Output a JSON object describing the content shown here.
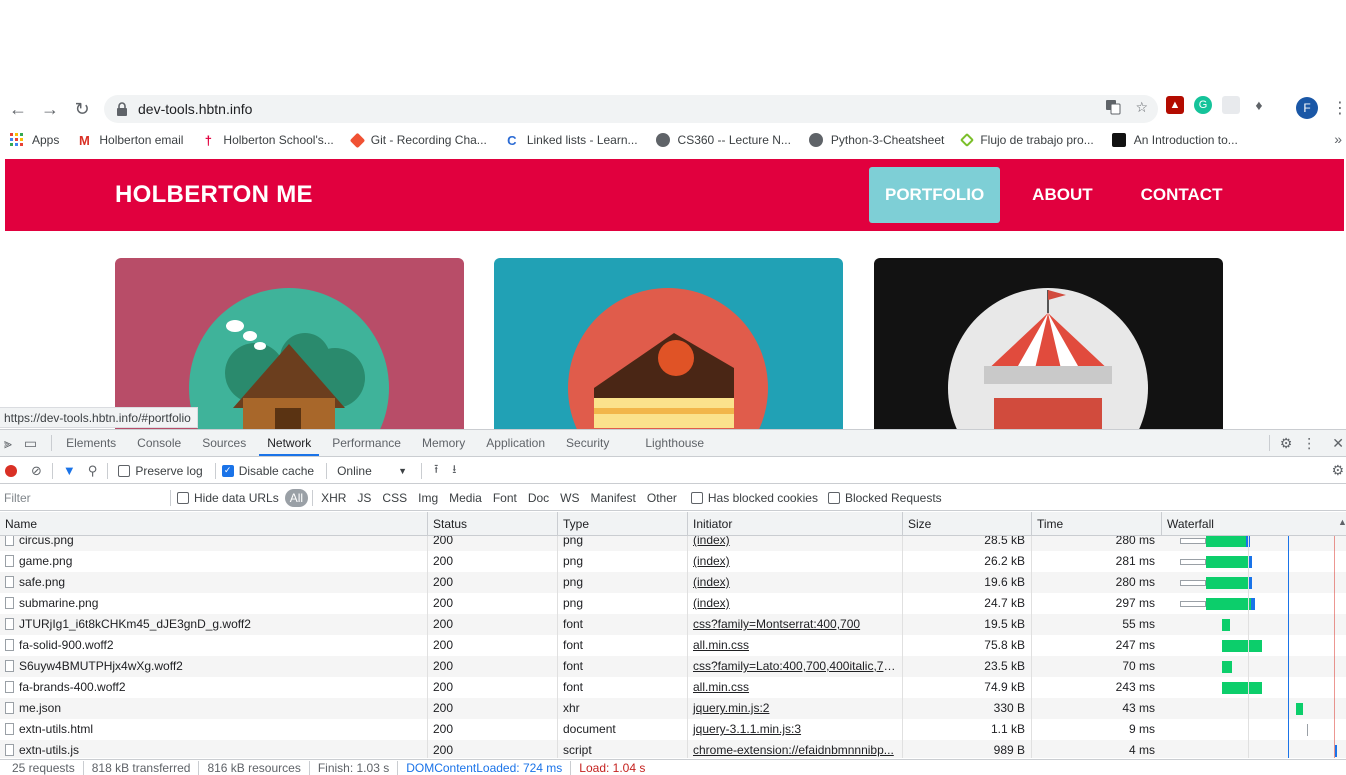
{
  "browser": {
    "url": "dev-tools.hbtn.info",
    "profile_initial": "F",
    "bookmarks": [
      {
        "label": "Apps",
        "icon": "apps-grid-icon",
        "color": "#e94235"
      },
      {
        "label": "Holberton email",
        "icon": "gmail-icon",
        "color": "#d93025"
      },
      {
        "label": "Holberton School's...",
        "icon": "holberton-icon",
        "color": "#e1003e"
      },
      {
        "label": "Git - Recording Cha...",
        "icon": "git-icon",
        "color": "#f05133"
      },
      {
        "label": "Linked lists - Learn...",
        "icon": "c-icon",
        "color": "#2b6bd4"
      },
      {
        "label": "CS360 -- Lecture N...",
        "icon": "globe-icon",
        "color": "#5f6368"
      },
      {
        "label": "Python-3-Cheatsheet",
        "icon": "globe-icon",
        "color": "#5f6368"
      },
      {
        "label": "Flujo de trabajo pro...",
        "icon": "diamond-icon",
        "color": "#7bbf2a"
      },
      {
        "label": "An Introduction to...",
        "icon": "dark-logo-icon",
        "color": "#111111"
      }
    ]
  },
  "site": {
    "brand": "HOLBERTON ME",
    "nav": [
      "PORTFOLIO",
      "ABOUT",
      "CONTACT"
    ],
    "colors": {
      "header": "#e1003e",
      "active_nav": "#7ecfd6",
      "card1": "#b84d68",
      "card2": "#21a1b5",
      "card3": "#121212"
    }
  },
  "status_tooltip": "https://dev-tools.hbtn.info/#portfolio",
  "devtools": {
    "tabs": [
      "Elements",
      "Console",
      "Sources",
      "Network",
      "Performance",
      "Memory",
      "Application",
      "Security",
      "Lighthouse"
    ],
    "active_tab": "Network",
    "toolbar": {
      "preserve_log": "Preserve log",
      "disable_cache": "Disable cache",
      "throttle": "Online"
    },
    "filter": {
      "placeholder": "Filter",
      "hide_data_urls": "Hide data URLs",
      "types": [
        "All",
        "XHR",
        "JS",
        "CSS",
        "Img",
        "Media",
        "Font",
        "Doc",
        "WS",
        "Manifest",
        "Other"
      ],
      "has_blocked_cookies": "Has blocked cookies",
      "blocked_requests": "Blocked Requests"
    },
    "columns": [
      "Name",
      "Status",
      "Type",
      "Initiator",
      "Size",
      "Time",
      "Waterfall"
    ],
    "rows": [
      {
        "name": "circus.png",
        "status": "200",
        "type": "png",
        "initiator": "(index)",
        "size": "28.5 kB",
        "time": "280 ms",
        "wf_start": 0.25,
        "wf_len": 0.25
      },
      {
        "name": "game.png",
        "status": "200",
        "type": "png",
        "initiator": "(index)",
        "size": "26.2 kB",
        "time": "281 ms",
        "wf_start": 0.25,
        "wf_len": 0.26
      },
      {
        "name": "safe.png",
        "status": "200",
        "type": "png",
        "initiator": "(index)",
        "size": "19.6 kB",
        "time": "280 ms",
        "wf_start": 0.25,
        "wf_len": 0.26
      },
      {
        "name": "submarine.png",
        "status": "200",
        "type": "png",
        "initiator": "(index)",
        "size": "24.7 kB",
        "time": "297 ms",
        "wf_start": 0.25,
        "wf_len": 0.28
      },
      {
        "name": "JTURjIg1_i6t8kCHKm45_dJE3gnD_g.woff2",
        "status": "200",
        "type": "font",
        "initiator": "css?family=Montserrat:400,700",
        "size": "19.5 kB",
        "time": "55 ms",
        "wf_start": 0.34,
        "wf_len": 0.05
      },
      {
        "name": "fa-solid-900.woff2",
        "status": "200",
        "type": "font",
        "initiator": "all.min.css",
        "size": "75.8 kB",
        "time": "247 ms",
        "wf_start": 0.34,
        "wf_len": 0.23
      },
      {
        "name": "S6uyw4BMUTPHjx4wXg.woff2",
        "status": "200",
        "type": "font",
        "initiator": "css?family=Lato:400,700,400italic,700...",
        "size": "23.5 kB",
        "time": "70 ms",
        "wf_start": 0.34,
        "wf_len": 0.06
      },
      {
        "name": "fa-brands-400.woff2",
        "status": "200",
        "type": "font",
        "initiator": "all.min.css",
        "size": "74.9 kB",
        "time": "243 ms",
        "wf_start": 0.34,
        "wf_len": 0.23
      },
      {
        "name": "me.json",
        "status": "200",
        "type": "xhr",
        "initiator": "jquery.min.js:2",
        "size": "330 B",
        "time": "43 ms",
        "wf_start": 0.76,
        "wf_len": 0.04
      },
      {
        "name": "extn-utils.html",
        "status": "200",
        "type": "document",
        "initiator": "jquery-3.1.1.min.js:3",
        "size": "1.1 kB",
        "time": "9 ms",
        "wf_start": 0.82,
        "wf_len": 0.01
      },
      {
        "name": "extn-utils.js",
        "status": "200",
        "type": "script",
        "initiator": "chrome-extension://efaidnbmnnnibp...",
        "size": "989 B",
        "time": "4 ms",
        "wf_start": 0.98,
        "wf_len": 0.01
      }
    ],
    "summary": {
      "requests": "25 requests",
      "transferred": "818 kB transferred",
      "resources": "816 kB resources",
      "finish": "Finish: 1.03 s",
      "dcl": "DOMContentLoaded: 724 ms",
      "load": "Load: 1.04 s"
    }
  }
}
